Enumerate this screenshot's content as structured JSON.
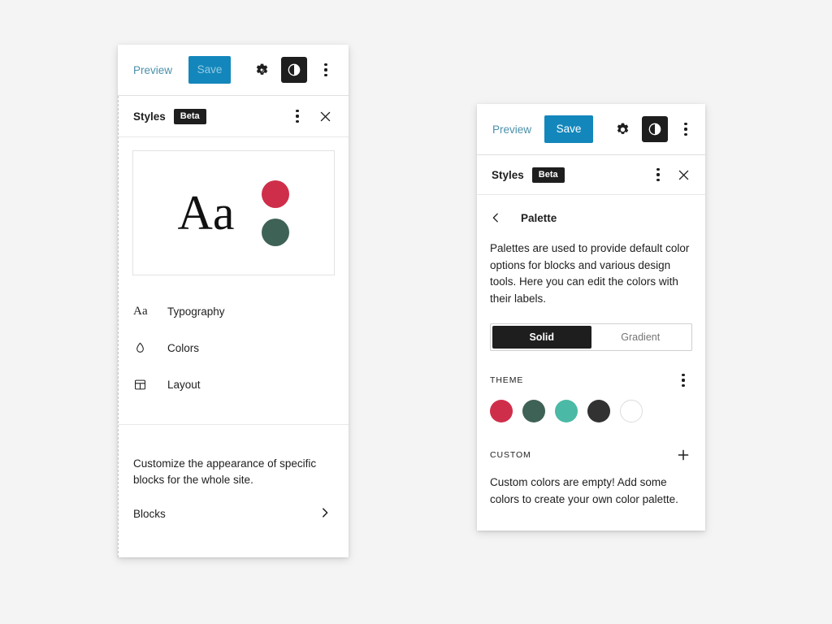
{
  "theme": {
    "save_blue": "#1387bc",
    "preview_link": "#4b90ab",
    "dark": "#1e1e1e",
    "page_bg": "#f4f4f4"
  },
  "left_panel": {
    "toolbar": {
      "preview_label": "Preview",
      "save_label": "Save",
      "gear_icon": "gear-icon",
      "contrast_icon": "contrast-icon",
      "more_icon": "kebab-menu-icon"
    },
    "header": {
      "title": "Styles",
      "badge": "Beta",
      "more_icon": "kebab-menu-icon",
      "close_icon": "close-icon"
    },
    "preview_card": {
      "sample_text": "Aa",
      "swatches": [
        "#cf2e4a",
        "#3f6256"
      ]
    },
    "nav_items": [
      {
        "label": "Typography",
        "icon": "typography-aa-icon",
        "glyph": "Aa"
      },
      {
        "label": "Colors",
        "icon": "droplet-icon",
        "glyph": ""
      },
      {
        "label": "Layout",
        "icon": "layout-icon",
        "glyph": ""
      }
    ],
    "blocks_section": {
      "description": "Customize the appearance of specific blocks for the whole site.",
      "link_label": "Blocks",
      "chevron_icon": "chevron-right-icon"
    }
  },
  "right_panel": {
    "toolbar": {
      "preview_label": "Preview",
      "save_label": "Save",
      "gear_icon": "gear-icon",
      "contrast_icon": "contrast-icon",
      "more_icon": "kebab-menu-icon"
    },
    "header": {
      "title": "Styles",
      "badge": "Beta",
      "more_icon": "kebab-menu-icon",
      "close_icon": "close-icon"
    },
    "breadcrumb": {
      "back_icon": "chevron-left-icon",
      "title": "Palette"
    },
    "description": "Palettes are used to provide default color options for blocks and various design tools. Here you can edit the colors with their labels.",
    "segmented_control": {
      "options": [
        "Solid",
        "Gradient"
      ],
      "selected": "Solid"
    },
    "theme_section": {
      "label": "THEME",
      "more_icon": "kebab-menu-icon",
      "swatches": [
        {
          "color": "#cf2e4a",
          "bordered": false
        },
        {
          "color": "#3f6256",
          "bordered": false
        },
        {
          "color": "#4ab9a5",
          "bordered": false
        },
        {
          "color": "#323232",
          "bordered": false
        },
        {
          "color": "#ffffff",
          "bordered": true
        }
      ]
    },
    "custom_section": {
      "label": "CUSTOM",
      "add_icon": "plus-icon",
      "empty_message": "Custom colors are empty! Add some colors to create your own color palette."
    }
  }
}
